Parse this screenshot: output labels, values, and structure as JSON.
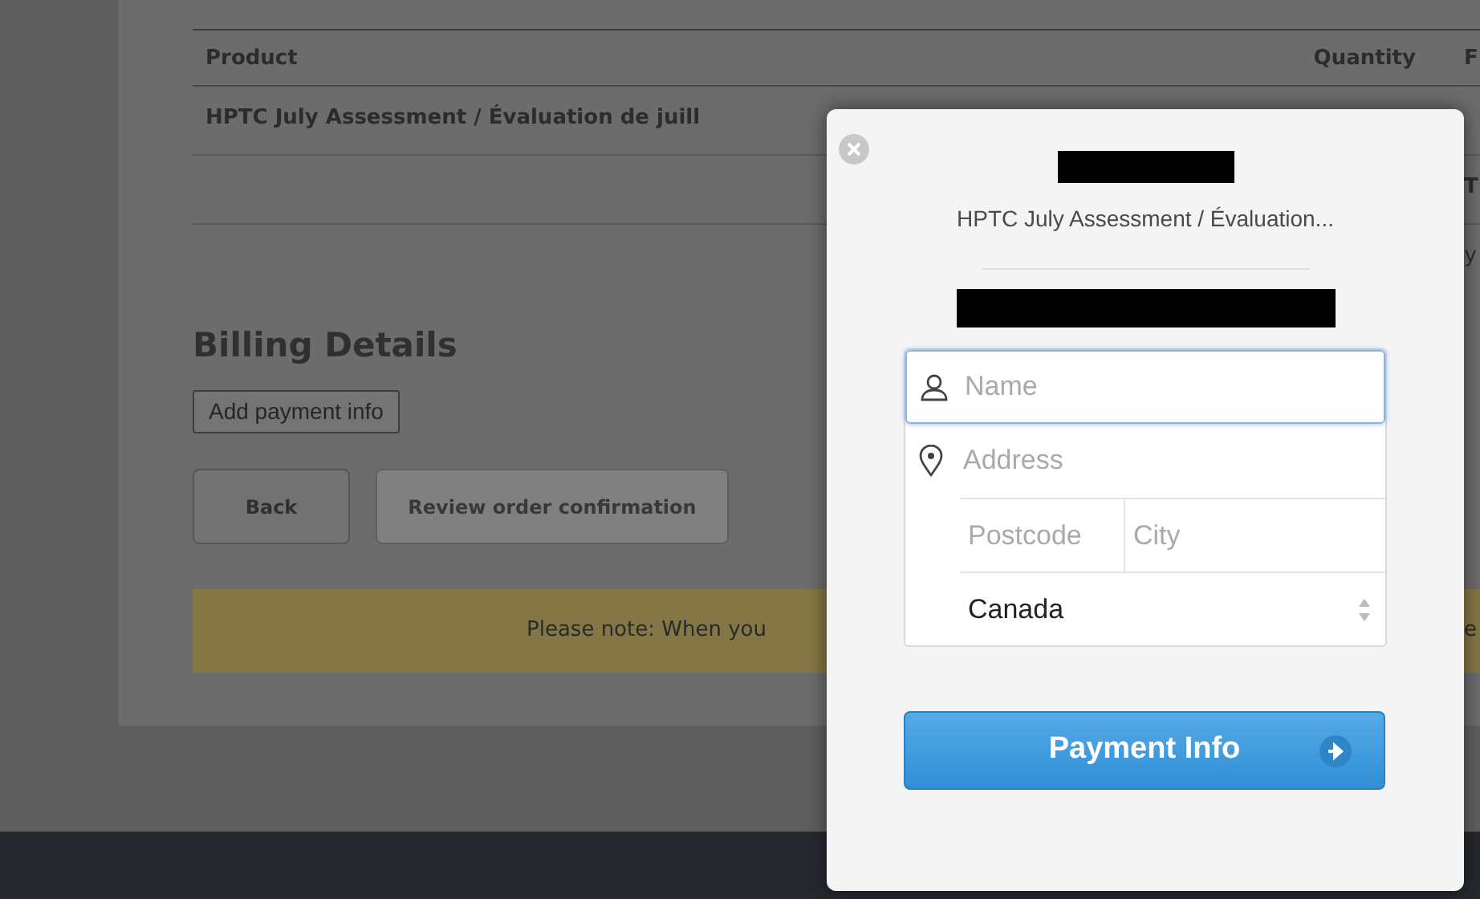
{
  "table": {
    "columns": [
      "Product",
      "Quantity",
      "F"
    ],
    "rows": [
      [
        "HPTC July Assessment / Évaluation de juill",
        "",
        ""
      ],
      [
        "",
        "",
        "T"
      ]
    ]
  },
  "side_fragment": "y",
  "billing": {
    "title": "Billing Details",
    "add_button": "Add payment info",
    "buttons": [
      {
        "label": "Back",
        "disabled": false
      },
      {
        "label": "Review order confirmation",
        "disabled": true
      }
    ]
  },
  "notice": {
    "text": "Please note: When you",
    "edge_fragment": "e"
  },
  "modal": {
    "product": "HPTC July Assessment / Évaluation...",
    "fields": [
      {
        "kind": "person",
        "placeholder": "Name",
        "focused": true
      },
      {
        "kind": "location",
        "placeholder": "Address",
        "focused": false
      },
      {
        "kind": "pair",
        "parts": [
          {
            "placeholder": "Postcode"
          },
          {
            "placeholder": "City"
          }
        ]
      },
      {
        "kind": "select",
        "value": "Canada"
      }
    ],
    "submit": "Payment Info"
  }
}
